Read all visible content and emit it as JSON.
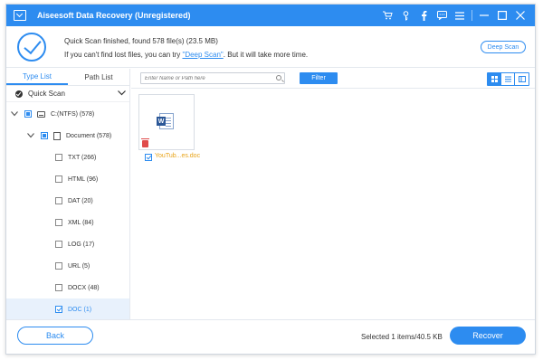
{
  "titlebar": {
    "title": "Aiseesoft Data Recovery (Unregistered)",
    "icons": [
      "cart-icon",
      "key-icon",
      "facebook-icon",
      "chat-icon",
      "menu-icon",
      "minimize-icon",
      "maximize-icon",
      "close-icon"
    ]
  },
  "status": {
    "line1": "Quick Scan finished, found 578 file(s) (23.5 MB)",
    "line2_pre": "If you can't find lost files, you can try ",
    "line2_link": "\"Deep Scan\"",
    "line2_post": ". But it will take more time.",
    "deep_scan_label": "Deep Scan"
  },
  "left": {
    "tabs": [
      {
        "label": "Type List",
        "active": true
      },
      {
        "label": "Path List",
        "active": false
      }
    ],
    "scan_mode": "Quick Scan",
    "tree": [
      {
        "label": "C:(NTFS) (578)",
        "level": 0,
        "check": "partial",
        "icon": "drive-icon",
        "expanded": true
      },
      {
        "label": "Document (578)",
        "level": 1,
        "check": "partial",
        "icon": "document-icon",
        "expanded": true
      },
      {
        "label": "TXT (266)",
        "level": 2,
        "check": "none"
      },
      {
        "label": "HTML (96)",
        "level": 2,
        "check": "none"
      },
      {
        "label": "DAT (20)",
        "level": 2,
        "check": "none"
      },
      {
        "label": "XML (84)",
        "level": 2,
        "check": "none"
      },
      {
        "label": "LOG (17)",
        "level": 2,
        "check": "none"
      },
      {
        "label": "URL (5)",
        "level": 2,
        "check": "none"
      },
      {
        "label": "DOCX (48)",
        "level": 2,
        "check": "none"
      },
      {
        "label": "DOC (1)",
        "level": 2,
        "check": "checked",
        "selected": true
      }
    ]
  },
  "toolbar": {
    "search_placeholder": "Enter Name or Path here",
    "filter_label": "Filter",
    "view_modes": [
      "grid-view-icon",
      "list-view-icon",
      "detail-view-icon"
    ],
    "active_view": 0
  },
  "content": {
    "files": [
      {
        "name": "YouTub...es.doc",
        "checked": true,
        "icon": "word-file-icon"
      }
    ]
  },
  "footer": {
    "back_label": "Back",
    "selected_info": "Selected 1 items/40.5 KB",
    "recover_label": "Recover"
  },
  "colors": {
    "accent": "#2d8cf0",
    "file_name": "#e8a317",
    "delete": "#e04b4b"
  }
}
